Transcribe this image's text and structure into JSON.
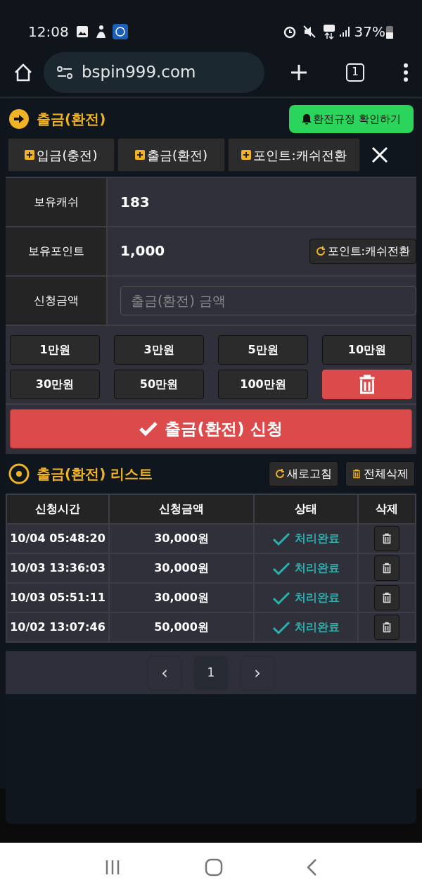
{
  "status_bar": {
    "time": "12:08",
    "battery": "37%"
  },
  "browser": {
    "url": "bspin999.com",
    "tab_count": "1"
  },
  "modal": {
    "title": "출금(환전)",
    "rules_button": "환전규정 확인하기",
    "tabs": [
      {
        "label": "입금(충전)"
      },
      {
        "label": "출금(환전)"
      },
      {
        "label": "포인트:캐쉬전환"
      }
    ],
    "form": {
      "cash_label": "보유캐쉬",
      "cash": "183",
      "points_label": "보유포인트",
      "points": "1,000",
      "convert_button": "포인트:캐쉬전환",
      "amount_label": "신청금액",
      "amount_placeholder": "출금(환전) 금액"
    },
    "amount_buttons": [
      "1만원",
      "3만원",
      "5만원",
      "10만원",
      "30만원",
      "50만원",
      "100만원"
    ],
    "submit_button": "출금(환전) 신청",
    "list": {
      "title": "출금(환전) 리스트",
      "refresh_button": "새로고침",
      "delete_all_button": "전체삭제",
      "columns": [
        "신청시간",
        "신청금액",
        "상태",
        "삭제"
      ],
      "rows": [
        {
          "time": "10/04 05:48:20",
          "amount": "30,000원",
          "status": "처리완료"
        },
        {
          "time": "10/03 13:36:03",
          "amount": "30,000원",
          "status": "처리완료"
        },
        {
          "time": "10/03 05:51:11",
          "amount": "30,000원",
          "status": "처리완료"
        },
        {
          "time": "10/02 13:07:46",
          "amount": "50,000원",
          "status": "처리완료"
        }
      ]
    },
    "pagination": {
      "prev": "‹",
      "next": "›",
      "pages": [
        {
          "label": "1",
          "selected": true
        }
      ]
    }
  }
}
